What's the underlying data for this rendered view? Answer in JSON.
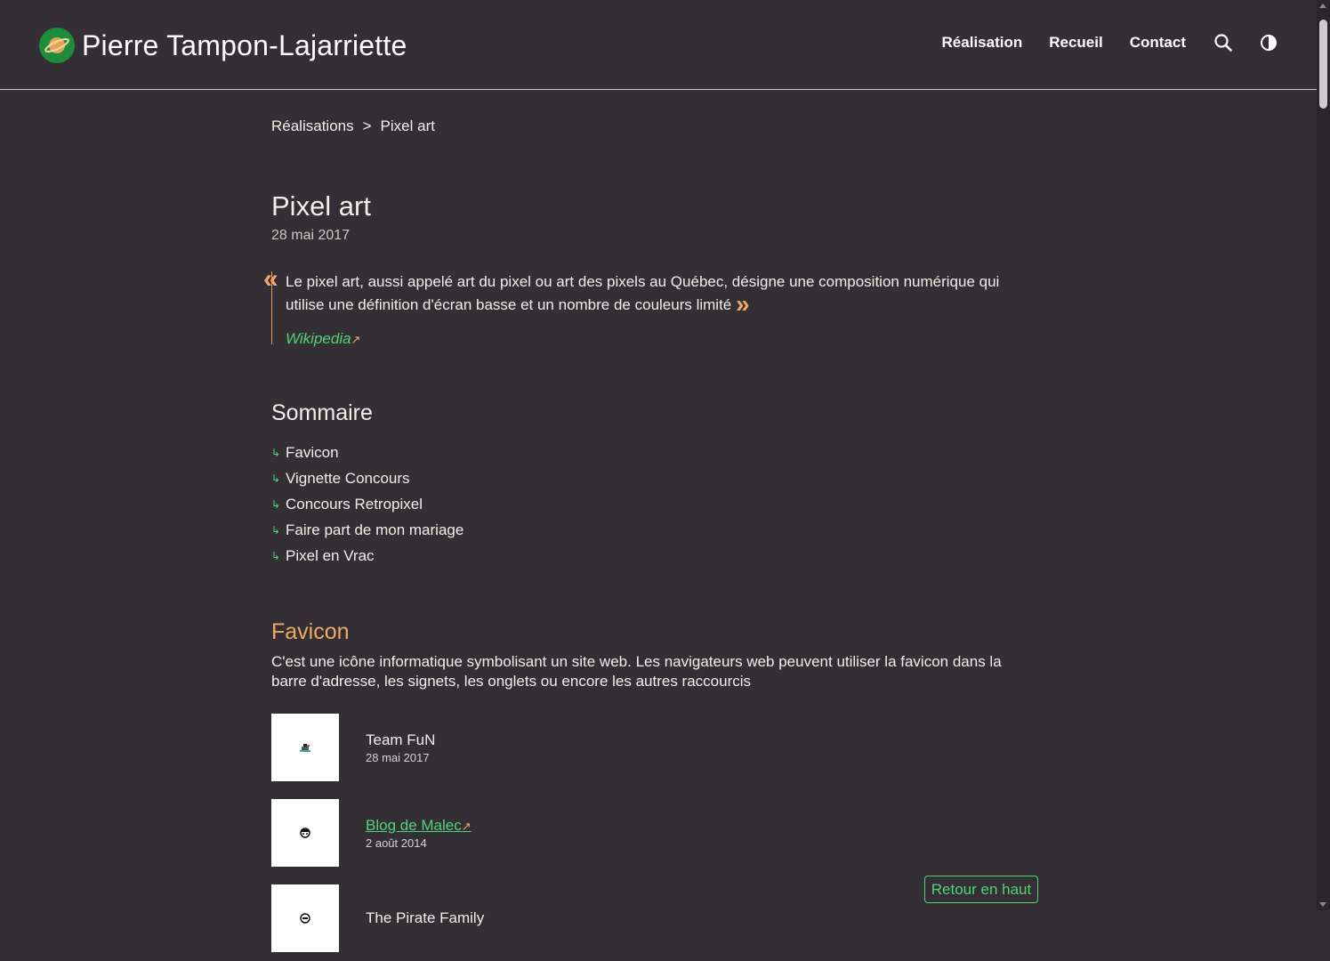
{
  "site": {
    "title": "Pierre Tampon-Lajarriette"
  },
  "nav": {
    "items": [
      {
        "label": "Réalisation"
      },
      {
        "label": "Recueil"
      },
      {
        "label": "Contact"
      }
    ]
  },
  "breadcrumb": {
    "parent": "Réalisations",
    "separator": ">",
    "current": "Pixel art"
  },
  "page": {
    "title": "Pixel art",
    "date": "28 mai 2017"
  },
  "quote": {
    "open_mark": "«",
    "text": "Le pixel art, aussi appelé art du pixel ou art des pixels au Québec, désigne une composition numérique qui utilise une définition d'écran basse et un nombre de couleurs limité",
    "close_mark": "»",
    "source": "Wikipedia",
    "external_mark": "↗"
  },
  "toc": {
    "title": "Sommaire",
    "arrow": "↳",
    "items": [
      {
        "label": "Favicon"
      },
      {
        "label": "Vignette Concours"
      },
      {
        "label": "Concours Retropixel"
      },
      {
        "label": "Faire part de mon mariage"
      },
      {
        "label": "Pixel en Vrac"
      }
    ]
  },
  "section": {
    "title": "Favicon",
    "description": "C'est une icône informatique symbolisant un site web. Les navigateurs web peuvent utiliser la favicon dans la barre d'adresse, les signets, les onglets ou encore les autres raccourcis",
    "items": [
      {
        "name": "Team FuN",
        "date": "28 mai 2017"
      },
      {
        "name": "Blog de Malec",
        "date": "2 août 2014",
        "external_mark": "↗"
      },
      {
        "name": "The Pirate Family"
      }
    ]
  },
  "back_to_top": {
    "label": "Retour en haut"
  },
  "colors": {
    "background": "#332f35",
    "accent_link": "#52d37a",
    "accent_orange": "#f0a865",
    "logo_green": "#1f8c3c"
  },
  "icons": {
    "logo": "planet-icon",
    "search": "search-icon",
    "theme": "contrast-icon",
    "toc": "return-arrow-icon"
  }
}
